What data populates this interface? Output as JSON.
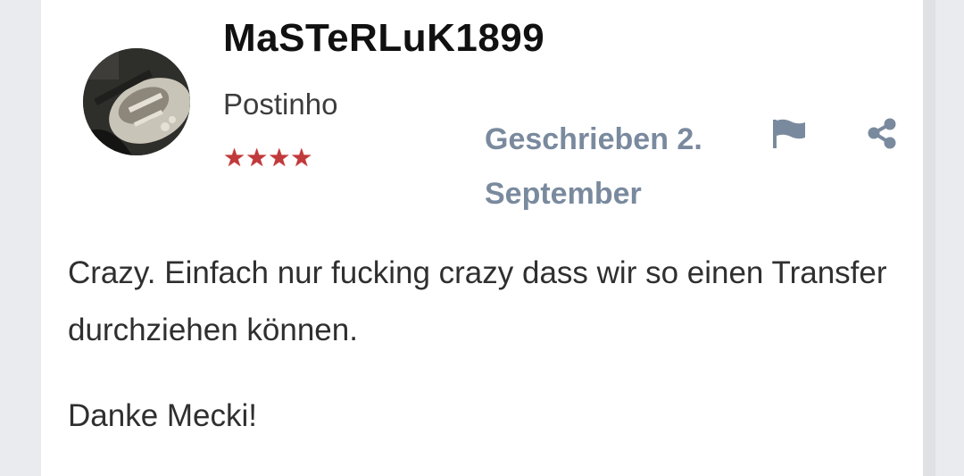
{
  "author": {
    "username": "MaSTeRLuK1899",
    "rank_title": "Postinho",
    "rank_stars": "★★★★",
    "avatar_icon": "guitar-photo-avatar"
  },
  "post": {
    "date_label": "Geschrieben 2. September",
    "paragraphs": [
      "Crazy. Einfach nur fucking crazy dass wir so einen Transfer durchziehen können.",
      "Danke Mecki!"
    ]
  },
  "actions": {
    "report_icon": "flag-icon",
    "share_icon": "share-icon"
  },
  "colors": {
    "meta_text": "#7a8a9e",
    "stars": "#c0393b",
    "page_bg": "#e9ebee",
    "card_bg": "#ffffff"
  }
}
